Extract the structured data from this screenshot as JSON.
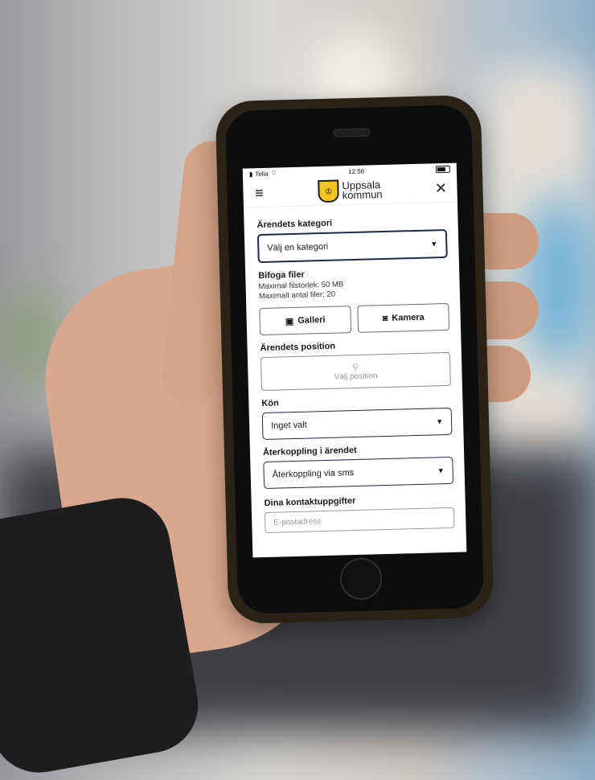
{
  "status_bar": {
    "carrier": "Telia",
    "time": "12:56"
  },
  "header": {
    "logo_line1": "Uppsala",
    "logo_line2": "kommun"
  },
  "form": {
    "category": {
      "label": "Ärendets kategori",
      "value": "Välj en kategori"
    },
    "attachments": {
      "label": "Bifoga filer",
      "max_size": "Maximal filstorlek: 50 MB",
      "max_files": "Maximalt antal filer: 20",
      "gallery_button": "Galleri",
      "camera_button": "Kamera"
    },
    "position": {
      "label": "Ärendets position",
      "placeholder": "Välj position"
    },
    "gender": {
      "label": "Kön",
      "value": "Inget valt"
    },
    "feedback": {
      "label": "Återkoppling i ärendet",
      "value": "Återkoppling via sms"
    },
    "contact": {
      "label": "Dina kontaktuppgifter",
      "email_placeholder": "E-postadress"
    }
  },
  "icons": [
    "menu-icon",
    "close-icon",
    "crest-icon",
    "image-icon",
    "camera-icon",
    "location-pin-icon",
    "caret-down-icon",
    "wifi-icon",
    "battery-icon"
  ],
  "colors": {
    "select_border": "#1f2a44",
    "crest": "#f2c61c",
    "text": "#1a1a1a"
  }
}
